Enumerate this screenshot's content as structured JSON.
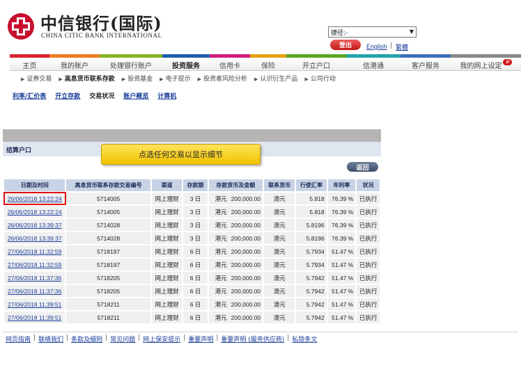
{
  "header": {
    "brand_cn": "中信银行(国际)",
    "brand_en": "CHINA CITIC BANK INTERNATIONAL",
    "quick_select": "捷径:-",
    "logout_label": "登出",
    "lang_en": "English",
    "lang_sep": "|",
    "lang_tc": "繁體"
  },
  "colors": {
    "brand_red": "#c8102e",
    "callout_yellow": "#f2c200",
    "highlight_red": "#e01010",
    "table_header": "#c8d3e6"
  },
  "nav": {
    "items": [
      {
        "label": "主页"
      },
      {
        "label": "我的账户"
      },
      {
        "label": "处理银行账户"
      },
      {
        "label": "投资服务"
      },
      {
        "label": "信用卡"
      },
      {
        "label": "保险"
      },
      {
        "label": "开立户口"
      },
      {
        "label": "信港通"
      },
      {
        "label": "客户服务"
      },
      {
        "label": "我的网上设定"
      }
    ],
    "new_badge": "新"
  },
  "sub_nav": {
    "items": [
      {
        "label": "证券交易"
      },
      {
        "label": "高息货币联系存款"
      },
      {
        "label": "投资基金"
      },
      {
        "label": "电子提示"
      },
      {
        "label": "投资者风险分析"
      },
      {
        "label": "认识衍生产品"
      },
      {
        "label": "公司行动"
      }
    ]
  },
  "tabs": [
    {
      "label": "利率/汇价表"
    },
    {
      "label": "开立存款"
    },
    {
      "label": "交易状况"
    },
    {
      "label": "账户概览"
    },
    {
      "label": "计算机"
    }
  ],
  "section_title": "结算户口",
  "back_label": "返回",
  "callout": "点选任何交易以显示细节",
  "table": {
    "headers": [
      "日期及时间",
      "高息货币联系存款交易编号",
      "渠道",
      "存款期",
      "存款货币及金额",
      "联系货币",
      "行使汇率",
      "年利率",
      "状况"
    ],
    "rows": [
      {
        "datetime": "26/06/2018 13:22:24",
        "ref": "5714005",
        "channel": "网上理财",
        "tenor": "3 日",
        "ccy": "港元",
        "amount": "200,000.00",
        "link_ccy": "澳元",
        "rate": "5.818",
        "interest": "76.39 %",
        "status": "已执行"
      },
      {
        "datetime": "26/06/2018 13:22:24",
        "ref": "5714005",
        "channel": "网上理财",
        "tenor": "3 日",
        "ccy": "港元",
        "amount": "200,000.00",
        "link_ccy": "澳元",
        "rate": "5.818",
        "interest": "76.39 %",
        "status": "已执行"
      },
      {
        "datetime": "26/06/2018 13:39:37",
        "ref": "5714028",
        "channel": "网上理财",
        "tenor": "3 日",
        "ccy": "港元",
        "amount": "200,000.00",
        "link_ccy": "澳元",
        "rate": "5.8196",
        "interest": "76.39 %",
        "status": "已执行"
      },
      {
        "datetime": "26/06/2018 13:39:37",
        "ref": "5714028",
        "channel": "网上理财",
        "tenor": "3 日",
        "ccy": "港元",
        "amount": "200,000.00",
        "link_ccy": "澳元",
        "rate": "5.8196",
        "interest": "76.39 %",
        "status": "已执行"
      },
      {
        "datetime": "27/06/2018 11:32:59",
        "ref": "5718197",
        "channel": "网上理财",
        "tenor": "6 日",
        "ccy": "港元",
        "amount": "200,000.00",
        "link_ccy": "澳元",
        "rate": "5.7934",
        "interest": "51.47 %",
        "status": "已执行"
      },
      {
        "datetime": "27/06/2018 11:32:59",
        "ref": "5718197",
        "channel": "网上理财",
        "tenor": "6 日",
        "ccy": "港元",
        "amount": "200,000.00",
        "link_ccy": "澳元",
        "rate": "5.7934",
        "interest": "51.47 %",
        "status": "已执行"
      },
      {
        "datetime": "27/06/2018 11:37:36",
        "ref": "5718205",
        "channel": "网上理财",
        "tenor": "6 日",
        "ccy": "港元",
        "amount": "200,000.00",
        "link_ccy": "澳元",
        "rate": "5.7942",
        "interest": "51.47 %",
        "status": "已执行"
      },
      {
        "datetime": "27/06/2018 11:37:36",
        "ref": "5718205",
        "channel": "网上理财",
        "tenor": "6 日",
        "ccy": "港元",
        "amount": "200,000.00",
        "link_ccy": "澳元",
        "rate": "5.7942",
        "interest": "51.47 %",
        "status": "已执行"
      },
      {
        "datetime": "27/06/2018 11:39:51",
        "ref": "5718211",
        "channel": "网上理财",
        "tenor": "6 日",
        "ccy": "港元",
        "amount": "200,000.00",
        "link_ccy": "澳元",
        "rate": "5.7942",
        "interest": "51.47 %",
        "status": "已执行"
      },
      {
        "datetime": "27/06/2018 11:39:51",
        "ref": "5718211",
        "channel": "网上理财",
        "tenor": "6 日",
        "ccy": "港元",
        "amount": "200,000.00",
        "link_ccy": "澳元",
        "rate": "5.7942",
        "interest": "51.47 %",
        "status": "已执行"
      }
    ]
  },
  "footer": {
    "links": [
      {
        "label": "网页指南"
      },
      {
        "label": "联络我们"
      },
      {
        "label": "条款及细则"
      },
      {
        "label": "常见问题"
      },
      {
        "label": "网上保安提示"
      },
      {
        "label": "重要声明"
      },
      {
        "label": "重要声明 (服务供应商)"
      },
      {
        "label": "私隐条文"
      }
    ],
    "sep": "|"
  }
}
